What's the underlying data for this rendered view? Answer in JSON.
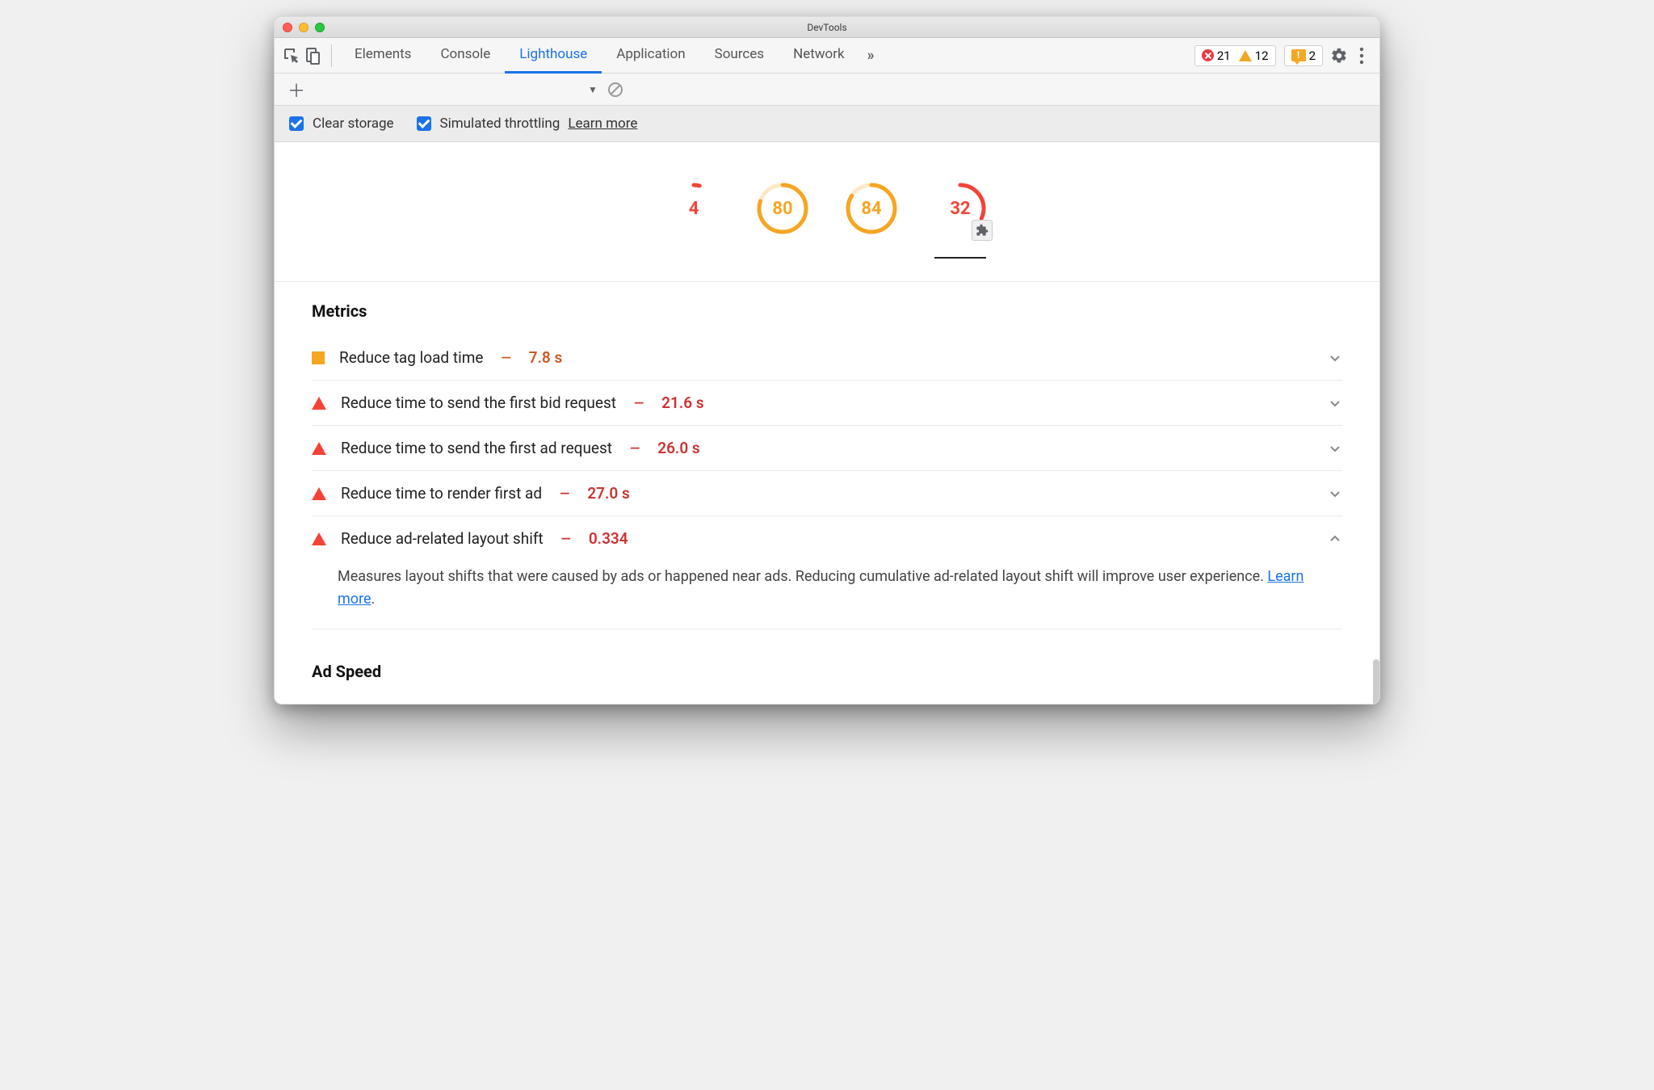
{
  "window": {
    "title": "DevTools"
  },
  "tabs": {
    "items": [
      "Elements",
      "Console",
      "Lighthouse",
      "Application",
      "Sources",
      "Network"
    ],
    "active": "Lighthouse"
  },
  "counters": {
    "errors": "21",
    "warnings": "12",
    "feedback": "2"
  },
  "options": {
    "clear_storage": "Clear storage",
    "simulated_throttling": "Simulated throttling",
    "learn_more": "Learn more"
  },
  "gauges": [
    {
      "score": "4",
      "pct": 4,
      "color": "red"
    },
    {
      "score": "80",
      "pct": 80,
      "color": "orange"
    },
    {
      "score": "84",
      "pct": 84,
      "color": "orange"
    },
    {
      "score": "32",
      "pct": 32,
      "color": "red",
      "plugin": true
    }
  ],
  "metrics_title": "Metrics",
  "metrics": [
    {
      "icon": "square",
      "name": "Reduce tag load time",
      "value": "7.8 s",
      "color": "orange",
      "expanded": false
    },
    {
      "icon": "triangle",
      "name": "Reduce time to send the first bid request",
      "value": "21.6 s",
      "color": "red",
      "expanded": false
    },
    {
      "icon": "triangle",
      "name": "Reduce time to send the first ad request",
      "value": "26.0 s",
      "color": "red",
      "expanded": false
    },
    {
      "icon": "triangle",
      "name": "Reduce time to render first ad",
      "value": "27.0 s",
      "color": "red",
      "expanded": false
    },
    {
      "icon": "triangle",
      "name": "Reduce ad-related layout shift",
      "value": "0.334",
      "color": "red",
      "expanded": true,
      "description": "Measures layout shifts that were caused by ads or happened near ads. Reducing cumulative ad-related layout shift will improve user experience. ",
      "link_text": "Learn more"
    }
  ],
  "ad_speed_title": "Ad Speed"
}
